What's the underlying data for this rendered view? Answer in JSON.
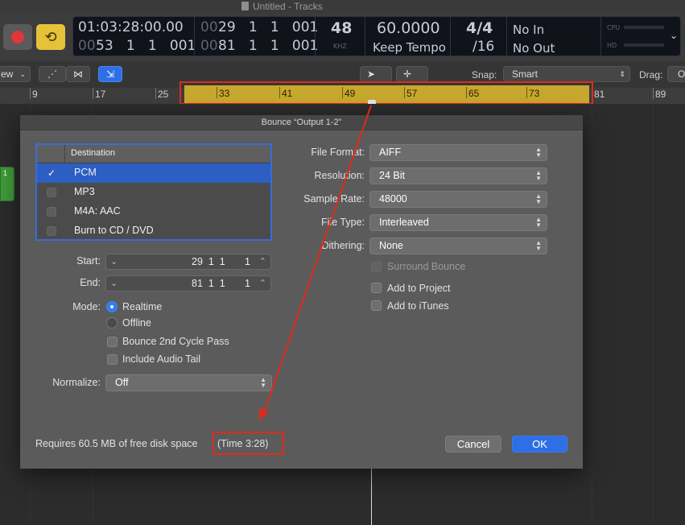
{
  "window": {
    "title": "Untitled - Tracks"
  },
  "control_bar": {
    "position_time": "01:03:28:00.00",
    "position_bars": "53   1   1   001",
    "position_bars_prefix": "00",
    "cycle_start_prefix": "00",
    "cycle_start": "29   1   1   001",
    "cycle_end_prefix": "00",
    "cycle_end": "81   1   1   001",
    "sample_rate": "48",
    "sample_rate_unit": "KHZ",
    "tempo": "60.0000",
    "tempo_mode": "Keep Tempo",
    "time_sig_top": "4/4",
    "time_sig_bottom": "/16",
    "midi_in": "No In",
    "midi_out": "No Out",
    "cpu_label": "CPU",
    "hd_label": "HD"
  },
  "toolbar": {
    "view_menu": "ew",
    "snap_label": "Snap:",
    "snap_value": "Smart",
    "drag_label": "Drag:",
    "drag_value": "O"
  },
  "ruler": {
    "bars_outside": [
      "9",
      "17",
      "25",
      "81",
      "89"
    ],
    "bars_cycle": [
      "33",
      "41",
      "49",
      "57",
      "65",
      "73"
    ]
  },
  "dialog": {
    "title": "Bounce “Output 1-2”",
    "destination_header": "Destination",
    "destinations": [
      {
        "name": "PCM",
        "checked": true
      },
      {
        "name": "MP3",
        "checked": false
      },
      {
        "name": "M4A: AAC",
        "checked": false
      },
      {
        "name": "Burn to CD / DVD",
        "checked": false
      }
    ],
    "start_label": "Start:",
    "start_value": "29  1  1       1",
    "end_label": "End:",
    "end_value": "81  1  1       1",
    "mode_label": "Mode:",
    "mode_realtime": "Realtime",
    "mode_offline": "Offline",
    "bounce_2nd_cycle": "Bounce 2nd Cycle Pass",
    "include_audio_tail": "Include Audio Tail",
    "normalize_label": "Normalize:",
    "normalize_value": "Off",
    "file_format_label": "File Format:",
    "file_format_value": "AIFF",
    "resolution_label": "Resolution:",
    "resolution_value": "24 Bit",
    "sample_rate_label": "Sample Rate:",
    "sample_rate_value": "48000",
    "file_type_label": "File Type:",
    "file_type_value": "Interleaved",
    "dithering_label": "Dithering:",
    "dithering_value": "None",
    "surround_bounce": "Surround Bounce",
    "add_to_project": "Add to Project",
    "add_to_itunes": "Add to iTunes",
    "disk_space": "Requires 60.5 MB of free disk space",
    "time_estimate": "(Time 3:28)",
    "cancel_label": "Cancel",
    "ok_label": "OK"
  },
  "colors": {
    "annotation": "#e02a1c",
    "cycle_region": "#c7a82f",
    "selection": "#2d5ec4",
    "ok_button": "#2f6fe6"
  }
}
